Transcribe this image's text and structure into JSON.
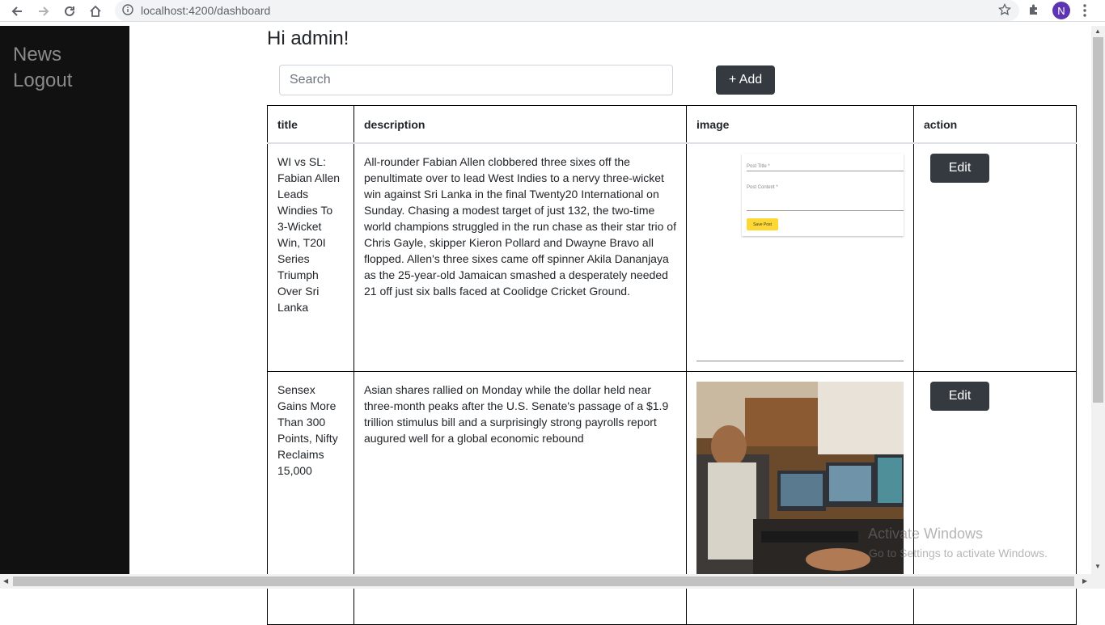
{
  "browser": {
    "url": "localhost:4200/dashboard",
    "profile_initial": "N"
  },
  "sidebar": {
    "items": [
      {
        "label": "News"
      },
      {
        "label": "Logout"
      }
    ]
  },
  "greeting": "Hi admin!",
  "search": {
    "placeholder": "Search",
    "value": ""
  },
  "add_button": "+ Add",
  "table": {
    "headers": [
      "title",
      "description",
      "image",
      "action"
    ],
    "rows": [
      {
        "title": "WI vs SL: Fabian Allen Leads Windies To 3-Wicket Win, T20I Series Triumph Over Sri Lanka",
        "description": "All-rounder Fabian Allen clobbered three sixes off the penultimate over to lead West Indies to a nervy three-wicket win against Sri Lanka in the final Twenty20 International on Sunday. Chasing a modest target of just 132, the two-time world champions struggled in the run chase as their star trio of Chris Gayle, skipper Kieron Pollard and Dwayne Bravo all flopped. Allen's three sixes came off spinner Akila Dananjaya as the 25-year-old Jamaican smashed a desperately needed 21 off just six balls faced at Coolidge Cricket Ground.",
        "image": {
          "post_title_label": "Post Title *",
          "post_content_label": "Post Content *",
          "save_button": "Save Post"
        },
        "action": "Edit"
      },
      {
        "title": "Sensex Gains More Than 300 Points, Nifty Reclaims 15,000",
        "description": "Asian shares rallied on Monday while the dollar held near three-month peaks after the U.S. Senate's passage of a $1.9 trillion stimulus bill and a surprisingly strong payrolls report augured well for a global economic rebound",
        "action": "Edit"
      }
    ]
  },
  "watermark": {
    "line1": "Activate Windows",
    "line2": "Go to Settings to activate Windows."
  }
}
